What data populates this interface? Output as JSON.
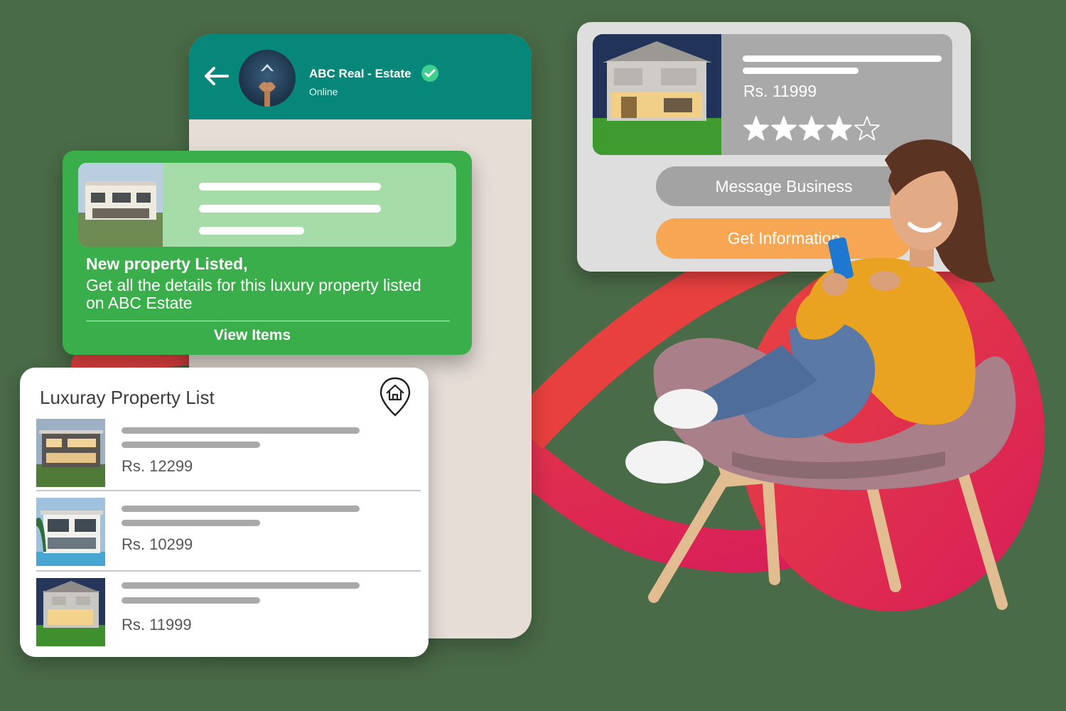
{
  "chat": {
    "contact_name": "ABC Real - Estate",
    "status": "Online"
  },
  "notification": {
    "title": "New property Listed,",
    "body": "Get all the details for this luxury property listed on ABC Estate",
    "action_label": "View Items"
  },
  "property_list": {
    "title": "Luxuray Property List",
    "items": [
      {
        "price": "Rs. 12299"
      },
      {
        "price": "Rs. 10299"
      },
      {
        "price": "Rs. 11999"
      }
    ]
  },
  "product": {
    "price": "Rs. 11999",
    "rating": 4,
    "rating_max": 5,
    "message_button_label": "Message Business",
    "info_button_label": "Get Information"
  },
  "colors": {
    "header_teal": "#07877a",
    "notification_green": "#3aae4a",
    "info_orange": "#f7a653",
    "ribbon_red": "#e43a3f"
  }
}
